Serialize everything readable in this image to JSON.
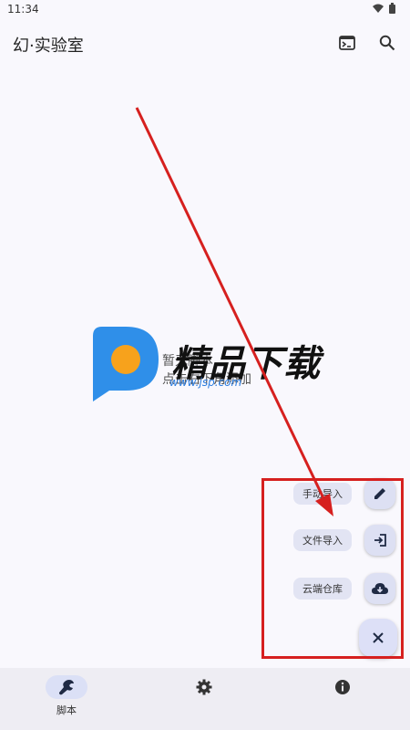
{
  "status_bar": {
    "time": "11:34",
    "icons": [
      "wifi-icon",
      "battery-icon"
    ]
  },
  "app_bar": {
    "title": "幻·实验室",
    "actions": [
      "terminal-icon",
      "search-icon"
    ]
  },
  "empty_state": {
    "line1": "暂无脚本",
    "line2": "点击右下角添加"
  },
  "watermark": {
    "text": "精品下载",
    "url": "www.jsp.com"
  },
  "fab_menu": {
    "items": [
      {
        "label": "手动导入",
        "icon": "pencil-icon"
      },
      {
        "label": "文件导入",
        "icon": "import-icon"
      },
      {
        "label": "云端仓库",
        "icon": "cloud-download-icon"
      }
    ],
    "close_icon": "close-icon"
  },
  "bottom_nav": {
    "items": [
      {
        "label": "脚本",
        "icon": "wrench-icon",
        "active": true
      },
      {
        "label": "",
        "icon": "settings-icon",
        "active": false
      },
      {
        "label": "",
        "icon": "info-icon",
        "active": false
      }
    ]
  },
  "colors": {
    "accent": "#dbe0f6",
    "annotation": "#d6201f",
    "background": "#f9f8fd"
  }
}
